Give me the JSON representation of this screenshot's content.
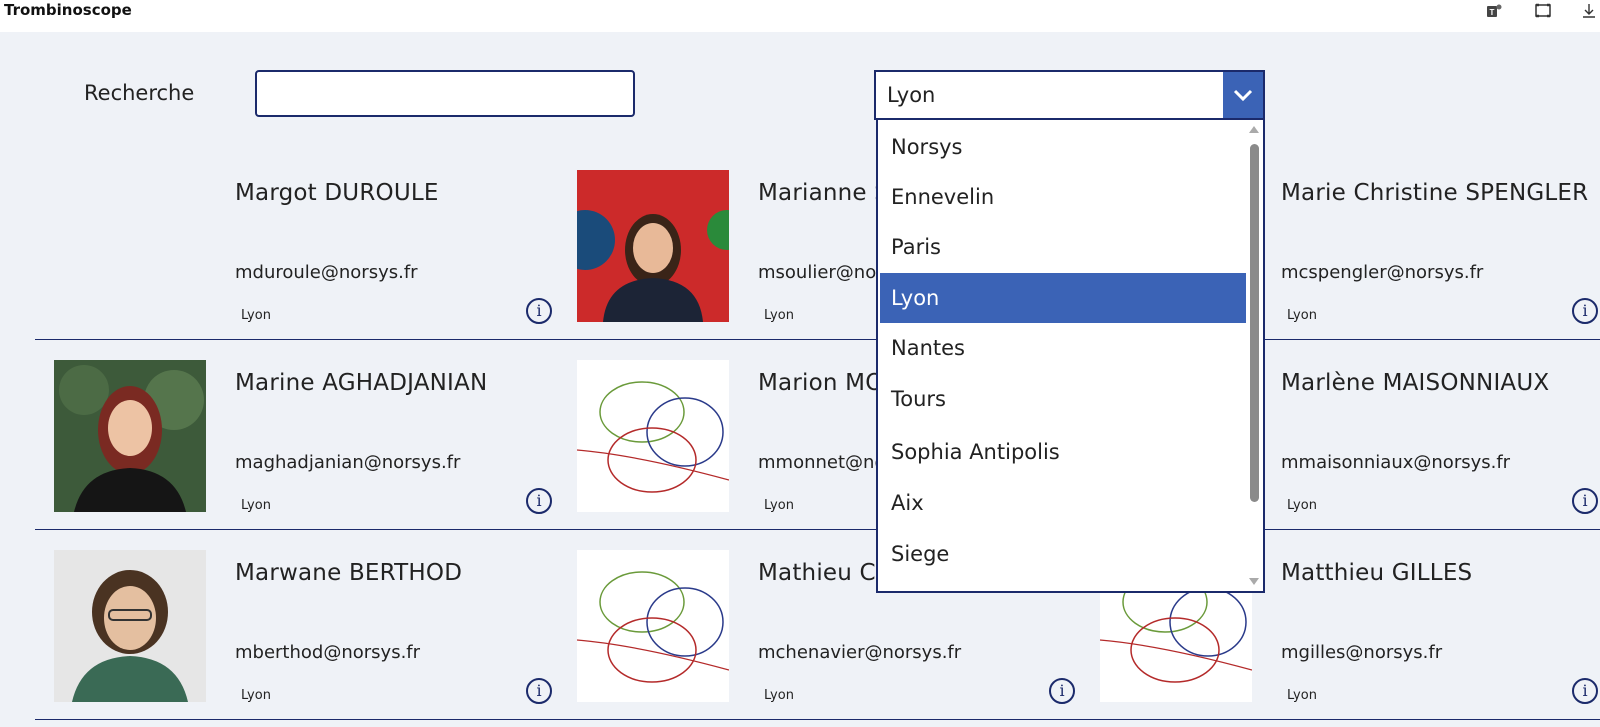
{
  "app": {
    "title": "Trombinoscope"
  },
  "search": {
    "label": "Recherche",
    "value": ""
  },
  "city_filter": {
    "selected": "Lyon",
    "options": [
      "Norsys",
      "Ennevelin",
      "Paris",
      "Lyon",
      "Nantes",
      "Tours",
      "Sophia Antipolis",
      "Aix",
      "Siege"
    ]
  },
  "people": [
    {
      "name": "Margot DUROULE",
      "email": "mduroule@norsys.fr",
      "city": "Lyon",
      "photo": "none"
    },
    {
      "name": "Marianne SOULIER",
      "email": "msoulier@norsys.fr",
      "city": "Lyon",
      "photo": "portrait"
    },
    {
      "name": "Marie Christine SPENGLER",
      "email": "mcspengler@norsys.fr",
      "city": "Lyon",
      "photo": "none"
    },
    {
      "name": "Marine AGHADJANIAN",
      "email": "maghadjanian@norsys.fr",
      "city": "Lyon",
      "photo": "portrait"
    },
    {
      "name": "Marion MONNET",
      "email": "mmonnet@norsys.fr",
      "city": "Lyon",
      "photo": "placeholder-logo"
    },
    {
      "name": "Marlène MAISONNIAUX",
      "email": "mmaisonniaux@norsys.fr",
      "city": "Lyon",
      "photo": "none"
    },
    {
      "name": "Marwane BERTHOD",
      "email": "mberthod@norsys.fr",
      "city": "Lyon",
      "photo": "portrait"
    },
    {
      "name": "Mathieu CHENAVIER",
      "email": "mchenavier@norsys.fr",
      "city": "Lyon",
      "photo": "placeholder-logo"
    },
    {
      "name": "Matthieu GILLES",
      "email": "mgilles@norsys.fr",
      "city": "Lyon",
      "photo": "placeholder-logo"
    }
  ],
  "icons": {
    "teams": "teams-icon",
    "fullscreen": "fullscreen-icon",
    "download": "download-icon",
    "info": "info-icon",
    "dropdown": "chevron-down-icon"
  },
  "colors": {
    "accent": "#3b63b6",
    "border": "#1b2a6b",
    "background": "#eff2f7"
  }
}
